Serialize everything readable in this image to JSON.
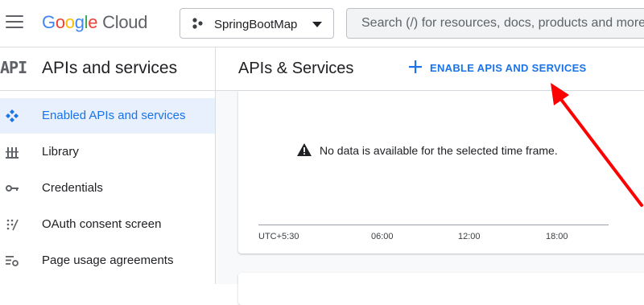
{
  "header": {
    "logo_letters": [
      "G",
      "o",
      "o",
      "g",
      "l",
      "e"
    ],
    "logo_suffix": "Cloud",
    "project_name": "SpringBootMap",
    "search_placeholder": "Search (/) for resources, docs, products and more"
  },
  "sidebar": {
    "badge": "API",
    "title": "APIs and services",
    "items": [
      {
        "label": "Enabled APIs and services",
        "icon": "enabled-apis-icon",
        "active": true
      },
      {
        "label": "Library",
        "icon": "library-icon",
        "active": false
      },
      {
        "label": "Credentials",
        "icon": "key-icon",
        "active": false
      },
      {
        "label": "OAuth consent screen",
        "icon": "oauth-icon",
        "active": false
      },
      {
        "label": "Page usage agreements",
        "icon": "settings-list-icon",
        "active": false
      }
    ]
  },
  "main": {
    "title": "APIs & Services",
    "enable_button": "ENABLE APIS AND SERVICES",
    "empty_message": "No data is available for the selected time frame.",
    "axis_ticks": [
      "UTC+5:30",
      "06:00",
      "12:00",
      "18:00"
    ]
  },
  "colors": {
    "accent": "#1a73e8",
    "active_bg": "#e8f0fe",
    "annotation_arrow": "#ff0000"
  }
}
